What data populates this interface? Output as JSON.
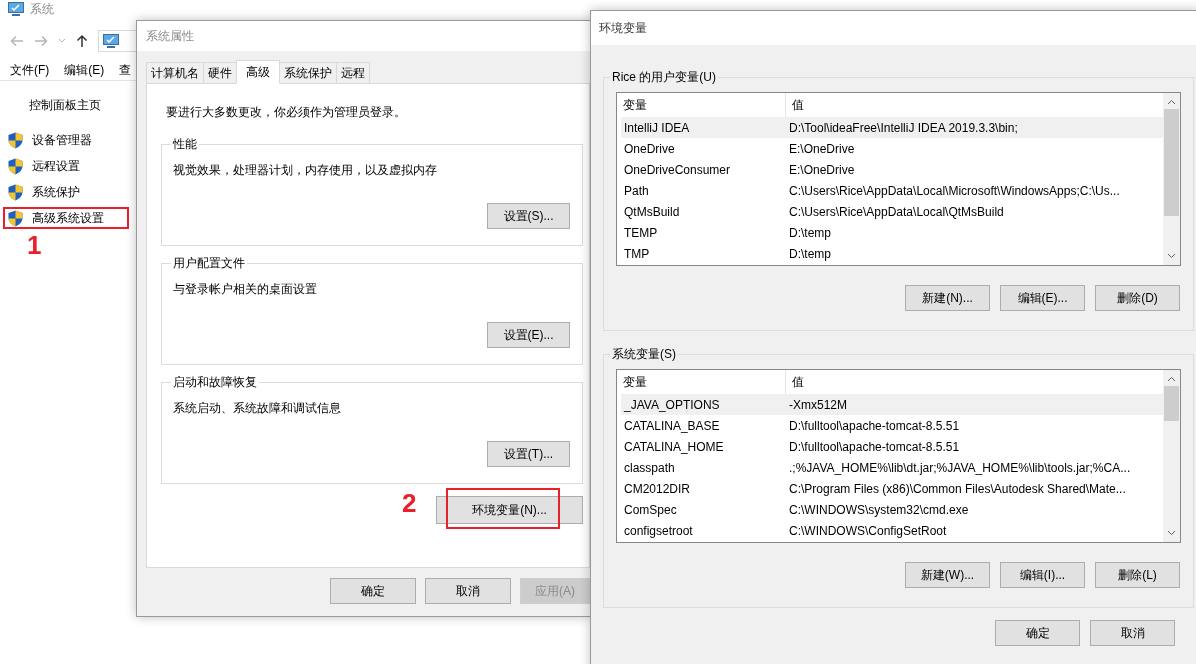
{
  "explorer": {
    "title": "系统",
    "menu": [
      "文件(F)",
      "编辑(E)",
      "查"
    ],
    "sidebar": {
      "home": "控制面板主页",
      "links": [
        {
          "label": "设备管理器",
          "highlighted": false
        },
        {
          "label": "远程设置",
          "highlighted": false
        },
        {
          "label": "系统保护",
          "highlighted": false
        },
        {
          "label": "高级系统设置",
          "highlighted": true,
          "marker": "1"
        }
      ]
    }
  },
  "system_properties": {
    "title": "系统属性",
    "tabs": [
      {
        "label": "计算机名",
        "selected": false
      },
      {
        "label": "硬件",
        "selected": false
      },
      {
        "label": "高级",
        "selected": true
      },
      {
        "label": "系统保护",
        "selected": false
      },
      {
        "label": "远程",
        "selected": false
      }
    ],
    "notice": "要进行大多数更改，你必须作为管理员登录。",
    "groups": [
      {
        "legend": "性能",
        "description": "视觉效果，处理器计划，内存使用，以及虚拟内存",
        "button": "设置(S)..."
      },
      {
        "legend": "用户配置文件",
        "description": "与登录帐户相关的桌面设置",
        "button": "设置(E)..."
      },
      {
        "legend": "启动和故障恢复",
        "description": "系统启动、系统故障和调试信息",
        "button": "设置(T)..."
      }
    ],
    "env_button": {
      "label": "环境变量(N)...",
      "highlighted": true,
      "marker": "2"
    },
    "footer": [
      {
        "label": "确定",
        "disabled": false
      },
      {
        "label": "取消",
        "disabled": false
      },
      {
        "label": "应用(A)",
        "disabled": true
      }
    ]
  },
  "environment_variables": {
    "title": "环境变量",
    "sections": [
      {
        "legend": "Rice 的用户变量(U)",
        "columns": [
          "变量",
          "值"
        ],
        "rows": [
          {
            "name": "IntelliJ IDEA",
            "value": "D:\\Tool\\ideaFree\\IntelliJ IDEA 2019.3.3\\bin;",
            "selected": true
          },
          {
            "name": "OneDrive",
            "value": "E:\\OneDrive",
            "selected": false
          },
          {
            "name": "OneDriveConsumer",
            "value": "E:\\OneDrive",
            "selected": false
          },
          {
            "name": "Path",
            "value": "C:\\Users\\Rice\\AppData\\Local\\Microsoft\\WindowsApps;C:\\Us...",
            "selected": false
          },
          {
            "name": "QtMsBuild",
            "value": "C:\\Users\\Rice\\AppData\\Local\\QtMsBuild",
            "selected": false
          },
          {
            "name": "TEMP",
            "value": "D:\\temp",
            "selected": false
          },
          {
            "name": "TMP",
            "value": "D:\\temp",
            "selected": false
          }
        ],
        "buttons": [
          "新建(N)...",
          "编辑(E)...",
          "删除(D)"
        ]
      },
      {
        "legend": "系统变量(S)",
        "columns": [
          "变量",
          "值"
        ],
        "rows": [
          {
            "name": "_JAVA_OPTIONS",
            "value": "-Xmx512M",
            "selected": true
          },
          {
            "name": "CATALINA_BASE",
            "value": "D:\\fulltool\\apache-tomcat-8.5.51",
            "selected": false
          },
          {
            "name": "CATALINA_HOME",
            "value": "D:\\fulltool\\apache-tomcat-8.5.51",
            "selected": false
          },
          {
            "name": "classpath",
            "value": ".;%JAVA_HOME%\\lib\\dt.jar;%JAVA_HOME%\\lib\\tools.jar;%CA...",
            "selected": false
          },
          {
            "name": "CM2012DIR",
            "value": "C:\\Program Files (x86)\\Common Files\\Autodesk Shared\\Mate...",
            "selected": false
          },
          {
            "name": "ComSpec",
            "value": "C:\\WINDOWS\\system32\\cmd.exe",
            "selected": false
          },
          {
            "name": "configsetroot",
            "value": "C:\\WINDOWS\\ConfigSetRoot",
            "selected": false
          }
        ],
        "buttons": [
          "新建(W)...",
          "编辑(I)...",
          "删除(L)"
        ]
      }
    ],
    "footer": [
      "确定",
      "取消"
    ]
  }
}
